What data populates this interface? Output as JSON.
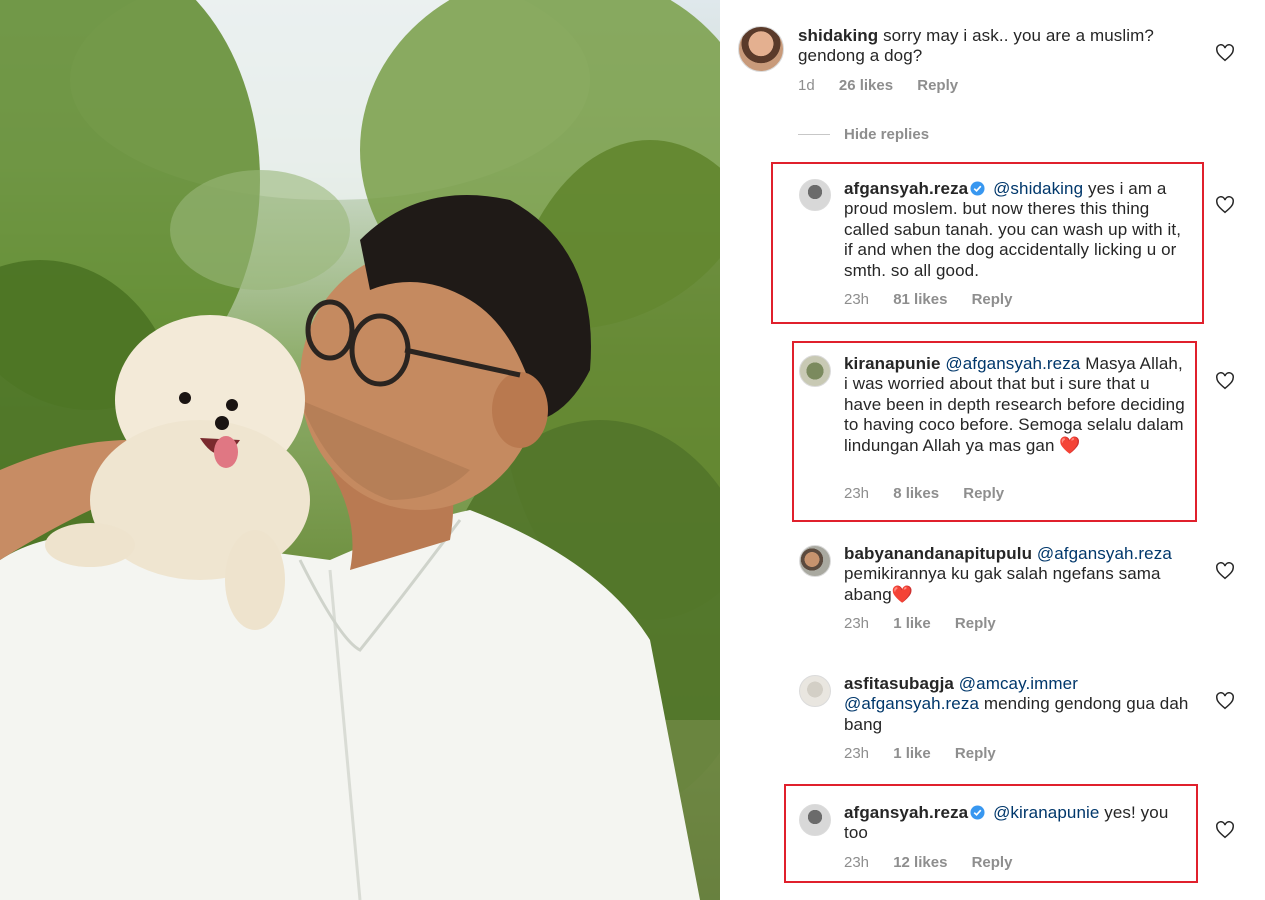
{
  "photo": {
    "subject_icon": "man-with-dog-photo"
  },
  "comments": {
    "top": {
      "username": "shidaking",
      "text": "sorry may i ask.. you are a muslim? gendong a dog?",
      "time": "1d",
      "likes": "26 likes",
      "reply": "Reply"
    },
    "hide_replies": "Hide replies",
    "replies": [
      {
        "username": "afgansyah.reza",
        "verified": true,
        "mention": "@shidaking",
        "text_line1": " yes i am a",
        "text_rest": "proud moslem. but now theres this thing called sabun tanah. you can wash up with it, if and when the dog accidentally licking u or smth. so all good.",
        "time": "23h",
        "likes": "81 likes",
        "reply": "Reply",
        "highlighted": true
      },
      {
        "username": "kiranapunie",
        "mention": "@afgansyah.reza",
        "text_line1": " Masya",
        "text_rest": "Allah, i was worried about that but i sure that u have been in depth research before deciding to having coco before. Semoga selalu dalam lindungan Allah ya mas gan",
        "emoji": "❤️",
        "time": "23h",
        "likes": "8 likes",
        "reply": "Reply",
        "highlighted": true
      },
      {
        "username": "babyanandanapitupulu",
        "mention": "@afgansyah.reza",
        "text": " pemikirannya ku gak salah ngefans sama abang",
        "emoji": "❤️",
        "time": "23h",
        "likes": "1 like",
        "reply": "Reply"
      },
      {
        "username": "asfitasubagja",
        "mention1": "@amcay.immer",
        "mention2": "@afgansyah.reza",
        "text": " mending gendong gua dah bang",
        "time": "23h",
        "likes": "1 like",
        "reply": "Reply"
      },
      {
        "username": "afgansyah.reza",
        "verified": true,
        "mention": "@kiranapunie",
        "text": " yes! you too",
        "time": "23h",
        "likes": "12 likes",
        "reply": "Reply",
        "highlighted": true
      }
    ]
  },
  "colors": {
    "text": "#262626",
    "meta": "#8e8e8e",
    "mention": "#00376b",
    "highlight_box": "#e0202c",
    "verified": "#3897f0"
  }
}
